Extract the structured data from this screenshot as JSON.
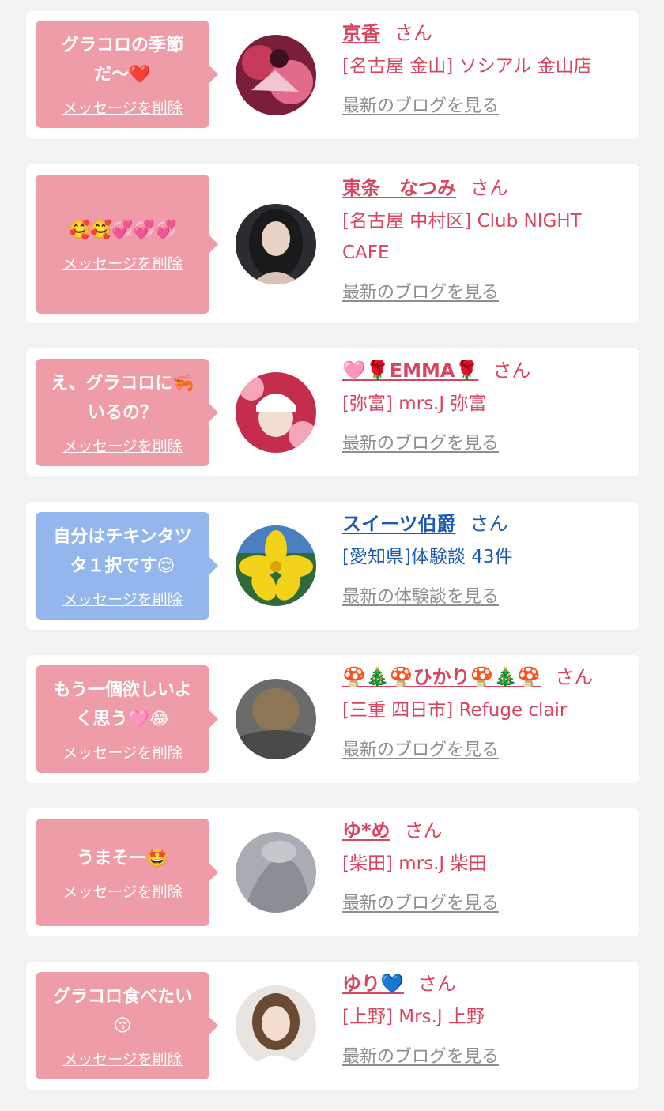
{
  "delete_label": "メッセージを削除",
  "honorific": "さん",
  "colors": {
    "bubble_pink": "#ee9ca8",
    "bubble_blue": "#93b7ec",
    "name_red": "#d8455f",
    "name_blue": "#1d5bb0",
    "link_gray": "#8e8e8e",
    "page_bg": "#f2f2f2"
  },
  "items": [
    {
      "message": "グラコロの季節だ〜❤️",
      "name": "京香",
      "shop": "[名古屋 金山] ソシアル 金山店",
      "link": "最新のブログを見る"
    },
    {
      "message": "🥰🥰💞💞💞",
      "name": "東条　なつみ",
      "shop": "[名古屋 中村区] Club NIGHT CAFE",
      "link": "最新のブログを見る"
    },
    {
      "message": "え、グラコロに🦐いるの？",
      "name": "🩷🌹EMMA🌹",
      "shop": "[弥富] mrs.J 弥富",
      "link": "最新のブログを見る"
    },
    {
      "message": "自分はチキンタツタ１択です😌",
      "name": "スイーツ伯爵",
      "shop": "[愛知県]体験談 43件",
      "link": "最新の体験談を見る"
    },
    {
      "message": "もう一個欲しいよく思う🩷😂",
      "name": "🍄🎄🍄ひかり🍄🎄🍄",
      "shop": "[三重 四日市] Refuge clair",
      "link": "最新のブログを見る"
    },
    {
      "message": "うまそー🤩",
      "name": "ゆ*め",
      "shop": "[柴田] mrs.J 柴田",
      "link": "最新のブログを見る"
    },
    {
      "message": "グラコロ食べたい😚",
      "name": "ゆり💙",
      "shop": "[上野] Mrs.J 上野",
      "link": "最新のブログを見る"
    }
  ]
}
